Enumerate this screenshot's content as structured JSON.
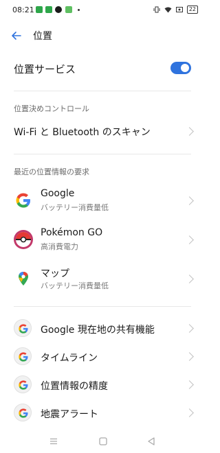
{
  "status": {
    "time": "08:21",
    "battery": "22",
    "left_icons": [
      {
        "name": "line-app-icon",
        "color": "#2ea64a"
      },
      {
        "name": "message-app-icon",
        "color": "#2ea64a"
      },
      {
        "name": "pokeball-notif-icon",
        "color": "#1a1a1a"
      },
      {
        "name": "leaf-app-icon",
        "color": "#5fbf62"
      }
    ]
  },
  "header": {
    "title": "位置"
  },
  "toggle": {
    "label": "位置サービス",
    "on": true,
    "accent": "#2f73de"
  },
  "controls": {
    "header": "位置決めコントロール",
    "wifi_bt_scan": "Wi-Fi と Bluetooth のスキャン"
  },
  "recent": {
    "header": "最近の位置情報の要求",
    "items": [
      {
        "title": "Google",
        "sub": "バッテリー消費量低",
        "icon": "google-icon"
      },
      {
        "title": "Pokémon GO",
        "sub": "高消費電力",
        "icon": "pokeball-icon"
      },
      {
        "title": "マップ",
        "sub": "バッテリー消費量低",
        "icon": "maps-pin-icon"
      }
    ]
  },
  "google_services": [
    {
      "title": "Google 現在地の共有機能",
      "icon": "google-icon"
    },
    {
      "title": "タイムライン",
      "icon": "google-icon"
    },
    {
      "title": "位置情報の精度",
      "icon": "google-icon"
    },
    {
      "title": "地震アラート",
      "icon": "google-icon"
    }
  ],
  "colors": {
    "google_blue": "#4285F4",
    "google_red": "#EA4335",
    "google_yellow": "#FBBC05",
    "google_green": "#34A853"
  }
}
